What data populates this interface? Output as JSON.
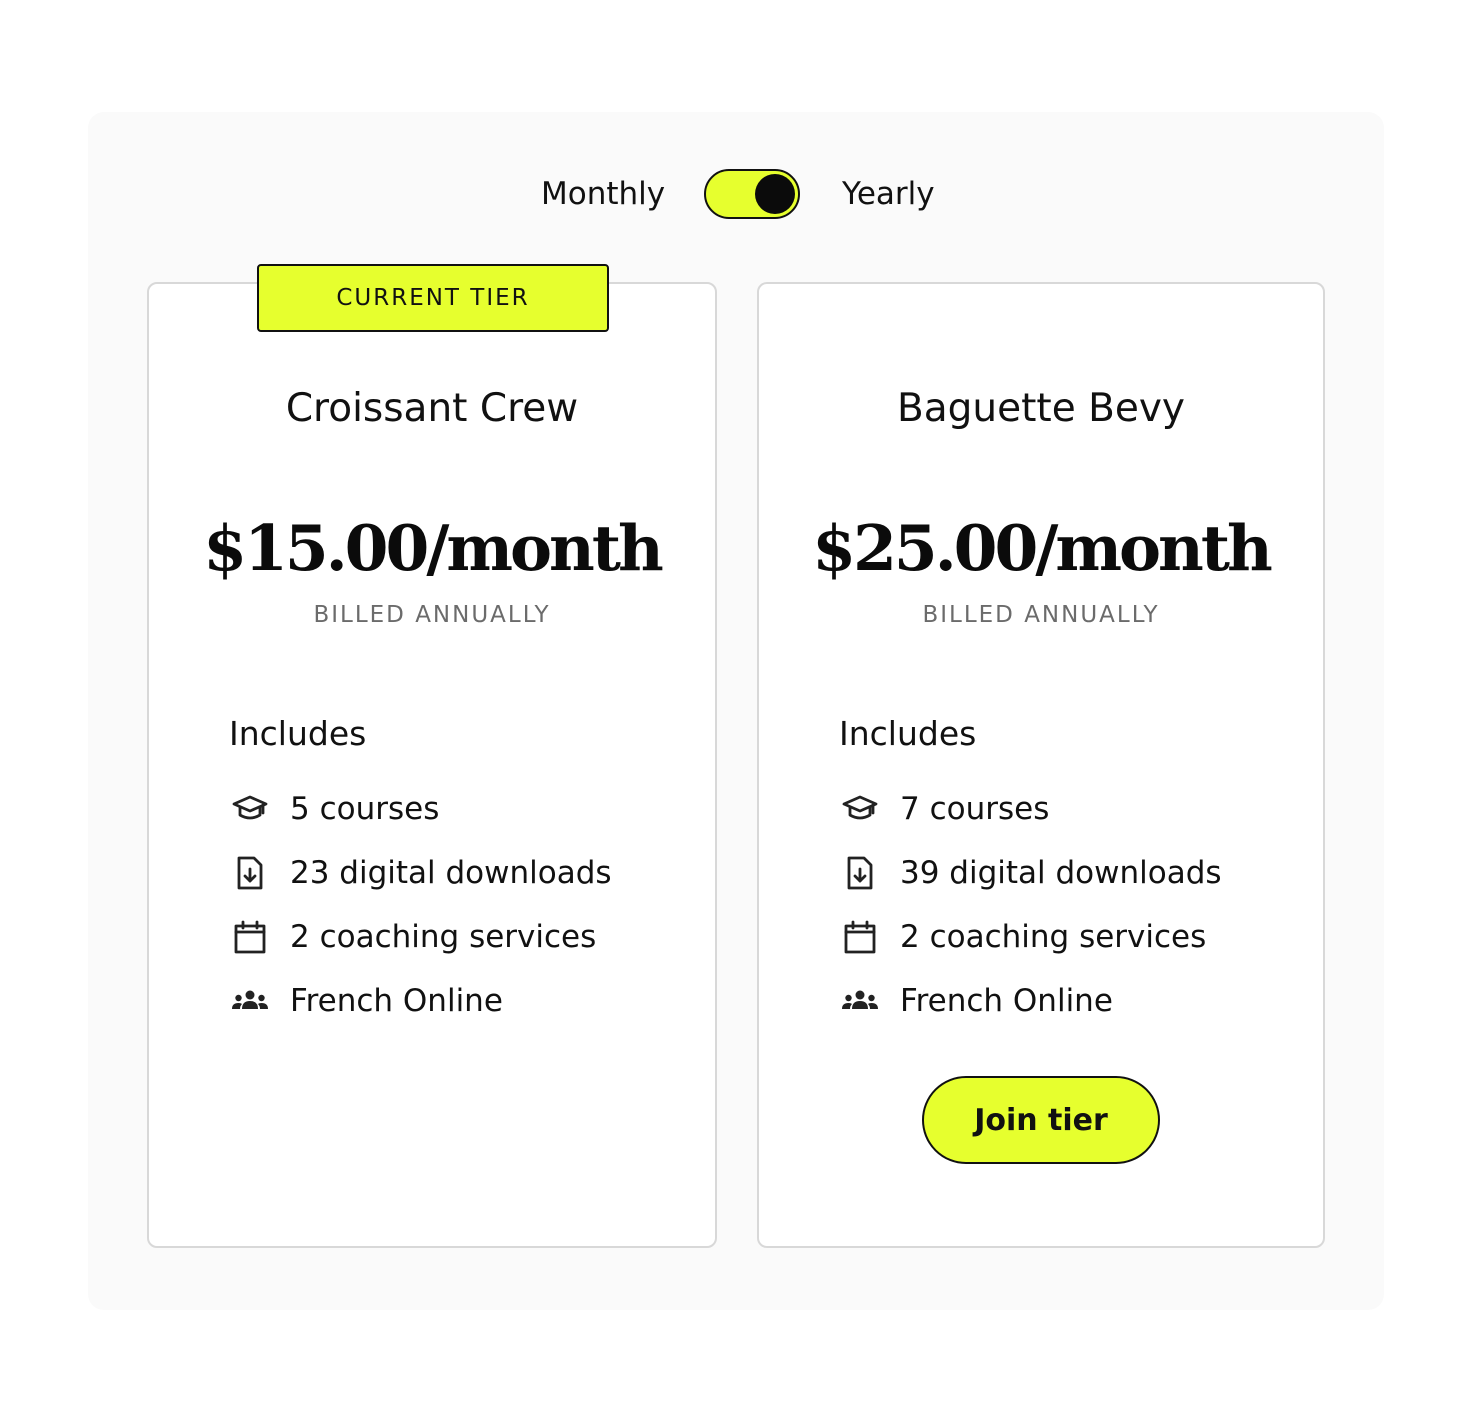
{
  "billing_toggle": {
    "monthly_label": "Monthly",
    "yearly_label": "Yearly",
    "selected": "Yearly"
  },
  "colors": {
    "accent": "#e6ff2e",
    "text": "#111111",
    "muted": "#6b6b6b",
    "card_border": "#d8d8d8",
    "panel_bg": "#fafafa"
  },
  "tiers": [
    {
      "badge": "CURRENT TIER",
      "name": "Croissant Crew",
      "price": "$15.00/month",
      "billing_note": "BILLED ANNUALLY",
      "includes_heading": "Includes",
      "features": [
        {
          "icon": "graduation-cap-icon",
          "text": "5 courses"
        },
        {
          "icon": "download-file-icon",
          "text": "23 digital downloads"
        },
        {
          "icon": "calendar-icon",
          "text": "2 coaching services"
        },
        {
          "icon": "community-icon",
          "text": "French Online"
        }
      ]
    },
    {
      "name": "Baguette Bevy",
      "price": "$25.00/month",
      "billing_note": "BILLED ANNUALLY",
      "includes_heading": "Includes",
      "features": [
        {
          "icon": "graduation-cap-icon",
          "text": "7 courses"
        },
        {
          "icon": "download-file-icon",
          "text": "39 digital downloads"
        },
        {
          "icon": "calendar-icon",
          "text": "2 coaching services"
        },
        {
          "icon": "community-icon",
          "text": "French Online"
        }
      ],
      "cta_label": "Join tier"
    }
  ]
}
